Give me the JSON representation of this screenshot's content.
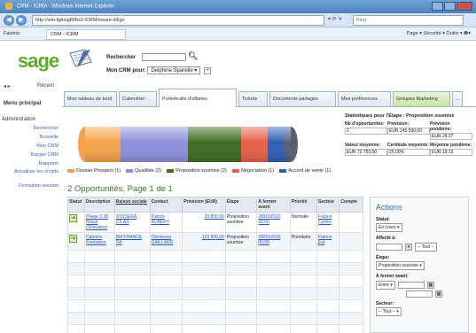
{
  "browser": {
    "title": "CRM - ICRM - Windows Internet Explorer",
    "url": "http://win-fgbiug80bs0:ICRM/eware.dll/go",
    "search_placeholder": "Bing",
    "favorites_label": "Favoris",
    "tab_label": "CRM - ICRM",
    "commands": "Page ▾   Sécurité ▾   Outils ▾   ❷▾"
  },
  "header": {
    "logo": "sage",
    "search_label": "Rechercher",
    "mycrm_label": "Mon CRM pour:",
    "mycrm_user": "Delphine Sparelle ▾",
    "add": "+"
  },
  "leftnav": {
    "back": "◂ ▸",
    "recent": "Récent",
    "main_menu": "Menu principal",
    "section": "Administration",
    "items": [
      {
        "label": "Rechercher",
        "two": false
      },
      {
        "label": "Nouvelle",
        "two": false
      },
      {
        "label": "Mon CRM",
        "two": false
      },
      {
        "label": "Équipe CRM",
        "two": false
      },
      {
        "label": "Rapports",
        "two": false
      },
      {
        "label": "Actualiser les scripts",
        "two": true
      },
      {
        "label": "Formation session",
        "two": true
      }
    ]
  },
  "tabs": [
    {
      "label": "Mon tableau de bord",
      "active": false,
      "green": false
    },
    {
      "label": "Calendrier",
      "active": false,
      "green": false
    },
    {
      "label": "Portefeuille d'affaires",
      "active": true,
      "green": false
    },
    {
      "label": "Tickets",
      "active": false,
      "green": false
    },
    {
      "label": "Documents partagés",
      "active": false,
      "green": false
    },
    {
      "label": "Mes préférences",
      "active": false,
      "green": false
    },
    {
      "label": "Groupes Marketing",
      "active": false,
      "green": true
    },
    {
      "label": "...",
      "active": false,
      "green": false
    }
  ],
  "pipeline": {
    "stages": [
      {
        "label": "Dossier Prospect (1)",
        "color": "#f5a24a"
      },
      {
        "label": "Qualifiée (2)",
        "color": "#8d8fdb"
      },
      {
        "label": "Proposition soumise (2)",
        "color": "#3f6b22"
      },
      {
        "label": "Négociation (1)",
        "color": "#e8604a"
      },
      {
        "label": "Accord de vente (1)",
        "color": "#2f5fb5"
      }
    ]
  },
  "stats": {
    "title": "Statistiques pour l'Étape : Proposition soumise",
    "cells": [
      {
        "label": "Nb d'opportunités:",
        "value": "2"
      },
      {
        "label": "Prévision:",
        "value": "EUR 145 500,00"
      },
      {
        "label": "Prévision pondérée:",
        "value": "EUR 28 27"
      },
      {
        "label": "Valeur moyenne:",
        "value": "EUR 72 750,00"
      },
      {
        "label": "Certitude moyenne:",
        "value": "25,00%"
      },
      {
        "label": "Moyenne pondérée:",
        "value": "EUR 18 13"
      }
    ]
  },
  "opps": {
    "title": "2 Opportunités, Page 1 de 1",
    "headers": [
      "Statut",
      "Description",
      "Raison sociale",
      "Contact",
      "Prévision (EUR)",
      "Étape",
      "À fermer avant",
      "Priorité",
      "Secteur",
      "Compte"
    ],
    "rows": [
      {
        "description": "Pliage 2.38 Robot d'élévateur",
        "company": "JOSSERA CILAG",
        "contact": "Patrick AUBERT",
        "forecast": "25 800,00",
        "stage": "Proposition soumise",
        "close": "28/03/2010 00:00",
        "priority": "Normale",
        "sector": "France Centre",
        "account": ""
      },
      {
        "description": "Caméra Formation",
        "company": "BM FRANCE SA",
        "contact": "Clémence GAILLARD",
        "forecast": "123 800,00",
        "stage": "Proposition soumise",
        "close": "28/03/2010 00:00",
        "priority": "Prioritaire",
        "sector": "France Est",
        "account": ""
      }
    ]
  },
  "actions": {
    "title": "Actions",
    "status_label": "Statut:",
    "status_value": "En cours ▾",
    "assigned_label": "Affecté à:",
    "assigned_value": "-- Tout --",
    "stage_label": "Étape:",
    "stage_value": "Proposition soumise ▾",
    "close_label": "À fermer avant:",
    "close_op": "Entre ▾",
    "sector_label": "Secteur:",
    "sector_value": "-- Tout -- ▾"
  }
}
